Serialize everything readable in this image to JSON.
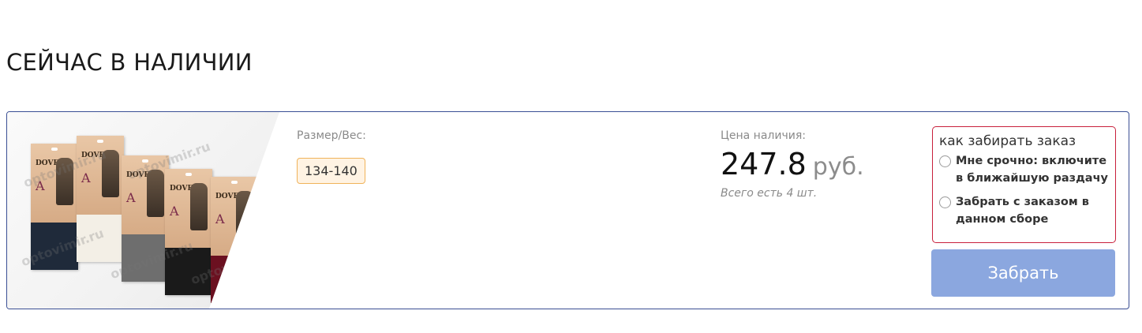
{
  "section": {
    "title": "СЕЙЧАС В НАЛИЧИИ"
  },
  "product": {
    "image_alt": "Adorica socks packs photo",
    "pack_brand": "DOVER",
    "pack_letter": "A",
    "watermark": "optovimir.ru",
    "size_label": "Размер/Вес:",
    "size_value": "134-140",
    "price_label": "Цена наличия:",
    "price": "247.8",
    "currency": "руб.",
    "stock_text": "Всего есть 4 шт."
  },
  "pickup": {
    "title": "как забирать заказ",
    "options": [
      {
        "label": "Мне срочно: включите в ближайшую раздачу",
        "checked": false
      },
      {
        "label": "Забрать с заказом в данном сборе",
        "checked": false
      }
    ],
    "button_label": "Забрать"
  },
  "colors": {
    "card_border": "#3a4f94",
    "pickup_border": "#c8203c",
    "button_bg": "#8ba7df",
    "chip_bg": "#fff3e3",
    "chip_border": "#f0b35a"
  }
}
